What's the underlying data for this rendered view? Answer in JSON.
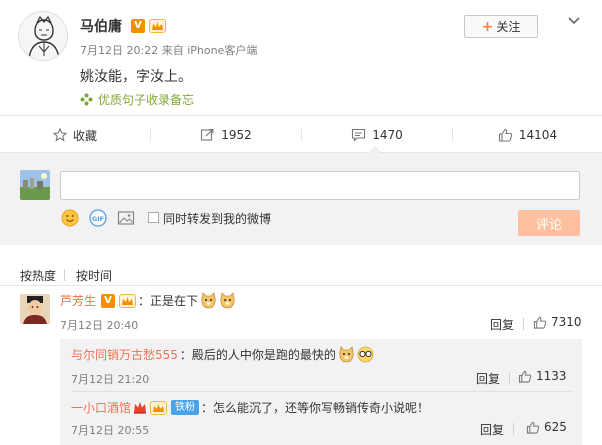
{
  "post": {
    "author": "马伯庸",
    "time": "7月12日 20:22",
    "source": "来自 iPhone客户端",
    "text": "姚汝能，字汝上。",
    "collection": "优质句子收录备忘",
    "follow_label": "关注"
  },
  "actions": {
    "favorite": "收藏",
    "repost": "1952",
    "comment": "1470",
    "like": "14104"
  },
  "compose": {
    "input_value": "",
    "sync_label": "同时转发到我的微博",
    "submit": "评论"
  },
  "sort": {
    "hot": "按热度",
    "time": "按时间"
  },
  "comments": [
    {
      "name": "芦芳生",
      "text": "：正是在下",
      "time": "7月12日 20:40",
      "reply": "回复",
      "likes": "7310"
    }
  ],
  "replies": [
    {
      "name": "与尔同销万古愁555",
      "text": "：殿后的人中你是跑的最快的",
      "time": "7月12日 21:20",
      "reply": "回复",
      "likes": "1133"
    },
    {
      "name": "一小口酒馆",
      "badge": "铁粉",
      "text": "：怎么能沉了，还等你写畅销传奇小说呢！",
      "time": "7月12日 20:55",
      "reply": "回复",
      "likes": "625"
    }
  ],
  "colors": {
    "accent": "#eb7350",
    "link": "#eb7350",
    "collection": "#80a838",
    "submit_disabled": "#ffc09f"
  }
}
